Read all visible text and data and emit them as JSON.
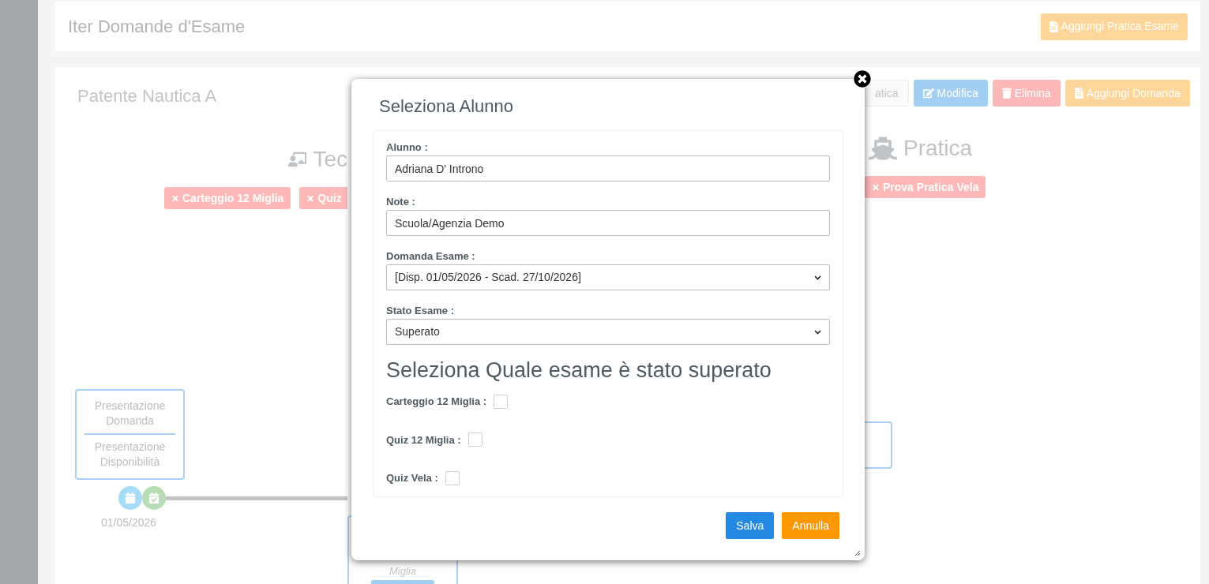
{
  "header": {
    "title": "Iter Domande d'Esame",
    "button": "Aggiungi Pratica Esame"
  },
  "course": {
    "title": "Patente Nautica A",
    "buttons": [
      {
        "label": "atica",
        "kind": "plain"
      },
      {
        "label": "Modifica",
        "kind": "edit"
      },
      {
        "label": "Elimina",
        "kind": "delete"
      },
      {
        "label": "Aggiungi Domanda",
        "kind": "add"
      }
    ],
    "sections": [
      {
        "label": "Tec",
        "kind": "theory"
      },
      {
        "label": "Pratica",
        "kind": "practice"
      }
    ],
    "tags_left": [
      "Carteggio 12 Miglia",
      "Quiz"
    ],
    "tags_right": [
      "Prova Pratica Vela"
    ],
    "step": {
      "top": "Presentazione Domanda",
      "bottom": "Presentazione Disponibilità",
      "date": "01/05/2026"
    },
    "lower_card": {
      "text": "Miglia"
    }
  },
  "dialog": {
    "title": "Seleziona Alunno",
    "fields": [
      {
        "label": "Alunno :",
        "kind": "text",
        "value": "Adriana D' Introno"
      },
      {
        "label": "Note :",
        "kind": "text",
        "value": "Scuola/Agenzia Demo"
      },
      {
        "label": "Domanda Esame :",
        "kind": "select",
        "value": "[Disp. 01/05/2026 - Scad. 27/10/2026]"
      },
      {
        "label": "Stato Esame :",
        "kind": "select",
        "value": "Superato"
      }
    ],
    "subheading": "Seleziona Quale esame è stato superato",
    "exams": [
      {
        "label": "Carteggio 12 Miglia :",
        "checked": false
      },
      {
        "label": "Quiz 12 Miglia :",
        "checked": false
      },
      {
        "label": "Quiz Vela :",
        "checked": false
      }
    ],
    "buttons": [
      {
        "label": "Salva",
        "kind": "primary"
      },
      {
        "label": "Annulla",
        "kind": "cancel"
      }
    ]
  }
}
